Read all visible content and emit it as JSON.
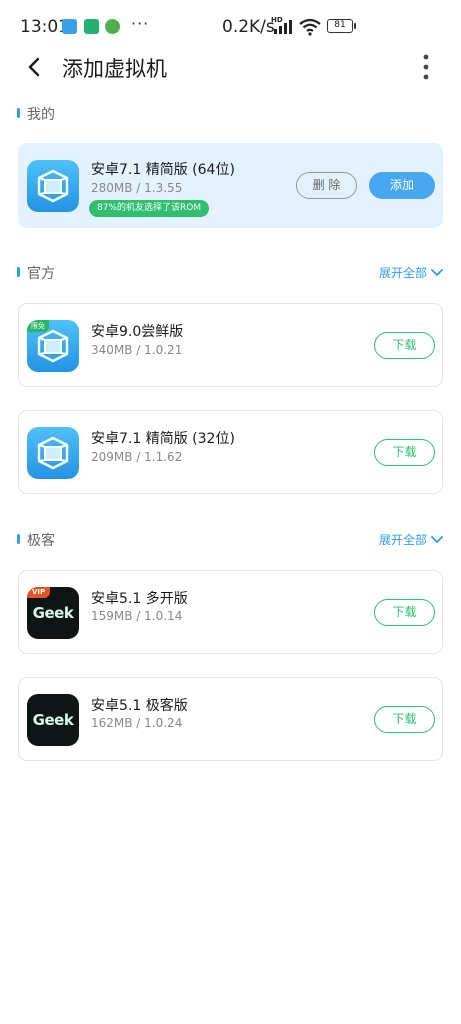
{
  "status_bar": {
    "time": "13:01",
    "overflow": "···",
    "net_speed": "0.2K/s",
    "hd": "HD",
    "battery": "81"
  },
  "header": {
    "title": "添加虚拟机",
    "back_icon": "chevron-left-icon",
    "more_icon": "more-vertical-icon"
  },
  "sections": {
    "mine": {
      "title": "我的"
    },
    "official": {
      "title": "官方",
      "expand": "展开全部"
    },
    "geek": {
      "title": "极客",
      "expand": "展开全部"
    }
  },
  "mine_item": {
    "name": "安卓7.1 精简版 (64位)",
    "meta": "280MB / 1.3.55",
    "badge": "87%的机友选择了该ROM",
    "delete_label": "删 除",
    "add_label": "添加"
  },
  "official_items": [
    {
      "name": "安卓9.0尝鲜版",
      "meta": "340MB / 1.0.21",
      "tag": "限免",
      "action": "下载"
    },
    {
      "name": "安卓7.1 精简版 (32位)",
      "meta": "209MB / 1.1.62",
      "action": "下载"
    }
  ],
  "geek_items": [
    {
      "name": "安卓5.1 多开版",
      "meta": "159MB / 1.0.14",
      "tag": "VIP",
      "logo": "Geek",
      "action": "下载"
    },
    {
      "name": "安卓5.1 极客版",
      "meta": "162MB / 1.0.24",
      "logo": "Geek",
      "action": "下载"
    }
  ],
  "colors": {
    "accent_blue": "#48a7f0",
    "accent_green": "#2fbf6e",
    "mine_card_bg": "#e3f2fe"
  }
}
